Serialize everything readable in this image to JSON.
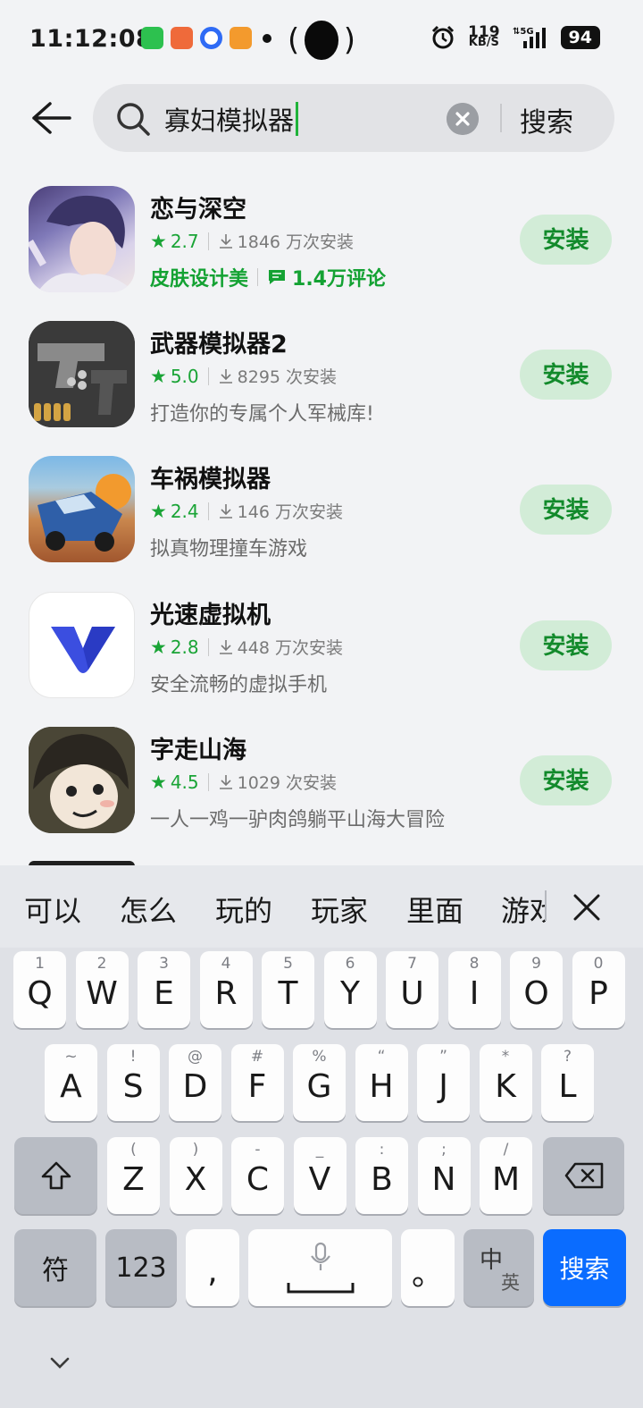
{
  "status_bar": {
    "time": "11:12:08",
    "net_speed_value": "119",
    "net_speed_unit": "KB/S",
    "network": "5G",
    "battery": "94"
  },
  "search": {
    "query": "寡妇模拟器",
    "button": "搜索"
  },
  "apps": [
    {
      "name": "恋与深空",
      "rating": "2.7",
      "installs": "1846 万次安装",
      "tag1": "皮肤设计美",
      "tag2": "1.4万评论",
      "install_label": "安装"
    },
    {
      "name": "武器模拟器2",
      "rating": "5.0",
      "installs": "8295 次安装",
      "desc": "打造你的专属个人军械库!",
      "install_label": "安装"
    },
    {
      "name": "车祸模拟器",
      "rating": "2.4",
      "installs": "146 万次安装",
      "desc": "拟真物理撞车游戏",
      "install_label": "安装"
    },
    {
      "name": "光速虚拟机",
      "rating": "2.8",
      "installs": "448 万次安装",
      "desc": "安全流畅的虚拟手机",
      "install_label": "安装"
    },
    {
      "name": "字走山海",
      "rating": "4.5",
      "installs": "1029 次安装",
      "desc": "一人一鸡一驴肉鸽躺平山海大冒险",
      "install_label": "安装"
    }
  ],
  "keyboard": {
    "candidates": [
      "可以",
      "怎么",
      "玩的",
      "玩家",
      "里面",
      "游戏"
    ],
    "row1": [
      {
        "main": "Q",
        "sub": "1"
      },
      {
        "main": "W",
        "sub": "2"
      },
      {
        "main": "E",
        "sub": "3"
      },
      {
        "main": "R",
        "sub": "4"
      },
      {
        "main": "T",
        "sub": "5"
      },
      {
        "main": "Y",
        "sub": "6"
      },
      {
        "main": "U",
        "sub": "7"
      },
      {
        "main": "I",
        "sub": "8"
      },
      {
        "main": "O",
        "sub": "9"
      },
      {
        "main": "P",
        "sub": "0"
      }
    ],
    "row2": [
      {
        "main": "A",
        "sub": "~"
      },
      {
        "main": "S",
        "sub": "!"
      },
      {
        "main": "D",
        "sub": "@"
      },
      {
        "main": "F",
        "sub": "#"
      },
      {
        "main": "G",
        "sub": "%"
      },
      {
        "main": "H",
        "sub": "“"
      },
      {
        "main": "J",
        "sub": "”"
      },
      {
        "main": "K",
        "sub": "*"
      },
      {
        "main": "L",
        "sub": "?"
      }
    ],
    "row3": [
      {
        "main": "Z",
        "sub": "("
      },
      {
        "main": "X",
        "sub": ")"
      },
      {
        "main": "C",
        "sub": "-"
      },
      {
        "main": "V",
        "sub": "_"
      },
      {
        "main": "B",
        "sub": ":"
      },
      {
        "main": "N",
        "sub": ";"
      },
      {
        "main": "M",
        "sub": "/"
      }
    ],
    "symbol_key": "符",
    "num_key": "123",
    "comma_key": ",",
    "period_key": "。",
    "lang_key_top": "中",
    "lang_key_bottom": "英",
    "search_key": "搜索"
  },
  "colors": {
    "accent_green": "#1aa436",
    "install_bg": "#d2ecd7",
    "keyboard_blue": "#0a6cff"
  }
}
